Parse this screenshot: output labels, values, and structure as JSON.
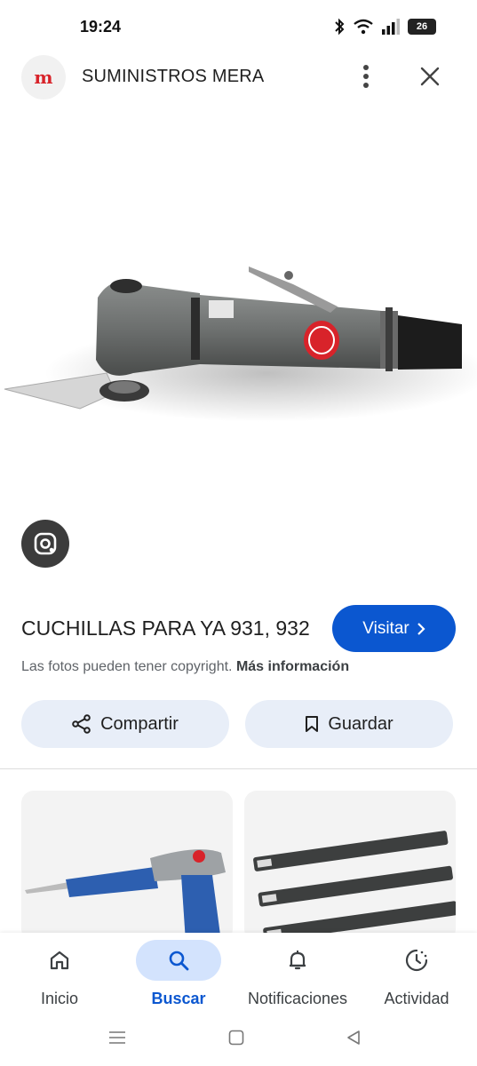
{
  "status_bar": {
    "time": "19:24",
    "battery": "26",
    "icons": [
      "bluetooth-icon",
      "wifi-icon",
      "signal-icon",
      "battery-icon"
    ]
  },
  "header": {
    "site_logo_text": "m",
    "site_name": "SUMINISTROS MERA",
    "icons": [
      "more-vert-icon",
      "close-icon"
    ]
  },
  "image_info": {
    "title": "CUCHILLAS PARA YA 931, 932",
    "visit_label": "Visitar",
    "copyright_text": "Las fotos pueden tener copyright.",
    "more_info_label": "Más información"
  },
  "actions": {
    "share_label": "Compartir",
    "save_label": "Guardar"
  },
  "bottom_nav": {
    "items": [
      {
        "label": "Inicio",
        "icon": "home-icon",
        "active": false
      },
      {
        "label": "Buscar",
        "icon": "search-icon",
        "active": true
      },
      {
        "label": "Notificaciones",
        "icon": "bell-icon",
        "active": false
      },
      {
        "label": "Actividad",
        "icon": "activity-icon",
        "active": false
      }
    ]
  },
  "colors": {
    "accent": "#0b57d0",
    "chip_background": "#e8eef8",
    "active_nav_pill": "#d3e3fd",
    "brand_red": "#d8232a"
  }
}
